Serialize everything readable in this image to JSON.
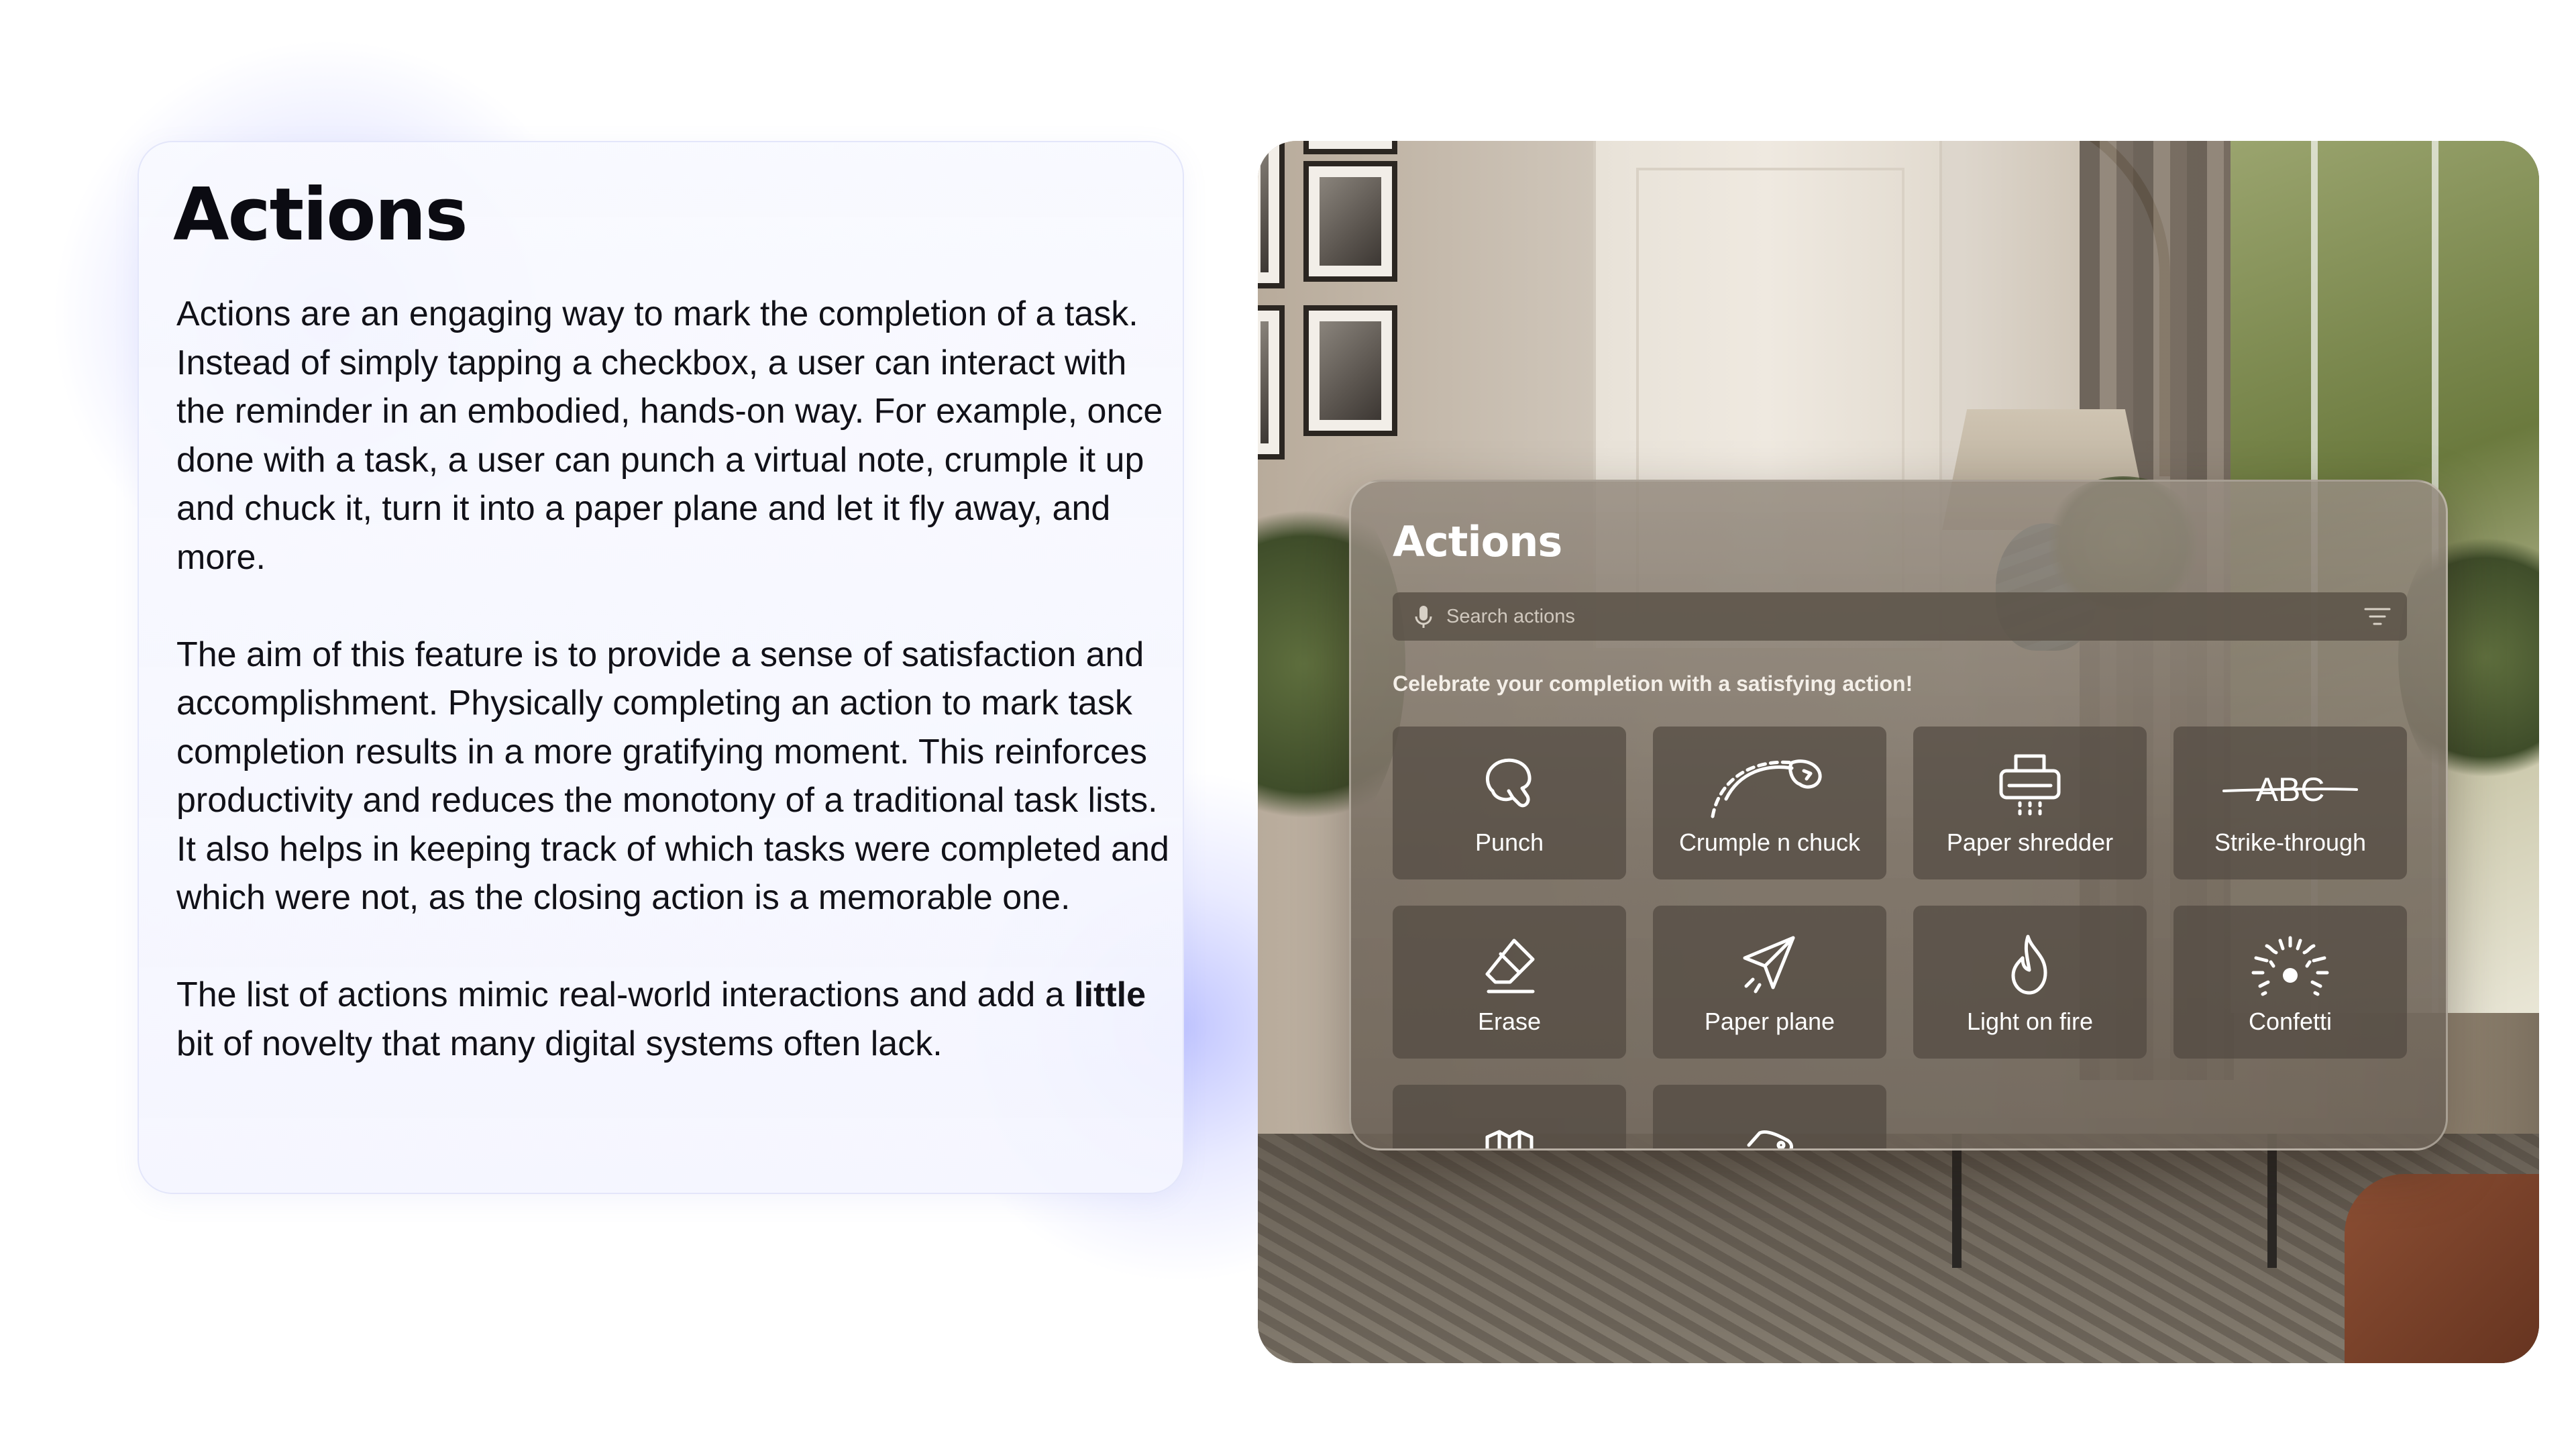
{
  "info": {
    "title": "Actions",
    "paragraph_1": "Actions are an engaging way to mark the completion of a task. Instead of simply tapping a checkbox, a user can interact with the reminder in an embodied, hands-on way. For example, once done with a task, a user can punch a virtual note, crumple it up and chuck it, turn it into a paper plane and let it fly away, and more.",
    "paragraph_2": "The aim of this feature is to provide a sense of satisfaction and accomplishment. Physically completing an action to mark task completion results in a more gratifying moment. This reinforces productivity and reduces the monotony of a traditional task lists. It also helps in keeping track of which tasks were completed and which were not, as the closing action is a memorable one.",
    "paragraph_3_before": "The list of actions mimic real-world interactions and add a ",
    "paragraph_3_bold": "little",
    "paragraph_3_after": " bit of novelty that many digital systems often lack."
  },
  "panel": {
    "title": "Actions",
    "search_placeholder": "Search actions",
    "subtitle": "Celebrate your completion with a satisfying action!",
    "actions": [
      {
        "label": "Punch",
        "icon": "punch-icon"
      },
      {
        "label": "Crumple n chuck",
        "icon": "crumple-chuck-icon"
      },
      {
        "label": "Paper shredder",
        "icon": "paper-shredder-icon"
      },
      {
        "label": "Strike-through",
        "icon": "strike-through-icon"
      },
      {
        "label": "Erase",
        "icon": "eraser-icon"
      },
      {
        "label": "Paper plane",
        "icon": "paper-plane-icon"
      },
      {
        "label": "Light on fire",
        "icon": "flame-icon"
      },
      {
        "label": "Confetti",
        "icon": "confetti-icon"
      },
      {
        "label": "",
        "icon": "fold-icon"
      },
      {
        "label": "",
        "icon": "tag-icon"
      }
    ],
    "strike_text": "ABC"
  },
  "colors": {
    "accent_glow": "#8e96ff",
    "panel_bg": "#786e62",
    "tile_bg": "#524a41"
  }
}
